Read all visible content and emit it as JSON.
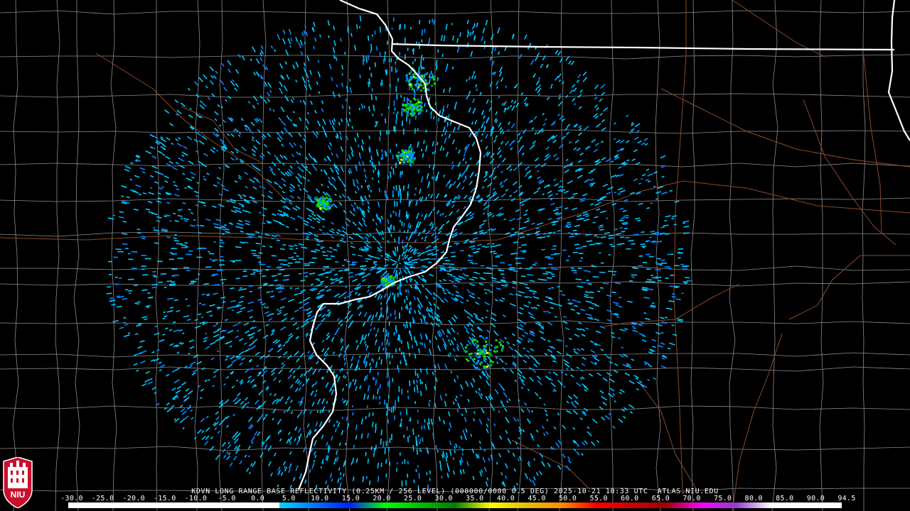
{
  "title": "KDVN LONG RANGE BASE REFLECTIVITY (0.25KM / 256 LEVEL) (000000/0000 0.5 DEG) 2025-10-21 10:33 UTC  ATLAS.NIU.EDU",
  "legend": {
    "ticks": [
      "-30.0",
      "-25.0",
      "-20.0",
      "-15.0",
      "-10.0",
      "-5.0",
      "0.0",
      "5.0",
      "10.0",
      "15.0",
      "20.0",
      "25.0",
      "30.0",
      "35.0",
      "40.0",
      "45.0",
      "50.0",
      "55.0",
      "60.0",
      "65.0",
      "70.0",
      "75.0",
      "80.0",
      "85.0",
      "90.0",
      "94.5"
    ],
    "colors": [
      "#000000",
      "#000000",
      "#000000",
      "#000000",
      "#000000",
      "#000000",
      "#00d8ff",
      "#0078ff",
      "#0020ff",
      "#00ff00",
      "#00c000",
      "#008000",
      "#ffff00",
      "#e6c000",
      "#ff9000",
      "#ff0000",
      "#d00000",
      "#a00000",
      "#ff00ff",
      "#9040d0",
      "#ffffff",
      "#ffffff"
    ]
  },
  "logo": {
    "text": "NIU",
    "color": "#c8102e"
  },
  "map": {
    "state_border_color": "#ffffff",
    "county_line_color": "#8c8c8c",
    "highway_color": "#8b4a2b",
    "echo_colors": [
      "#00c8ff",
      "#0090ff",
      "#1e78ff",
      "#14dc14",
      "#00a000",
      "#ffff00"
    ]
  }
}
